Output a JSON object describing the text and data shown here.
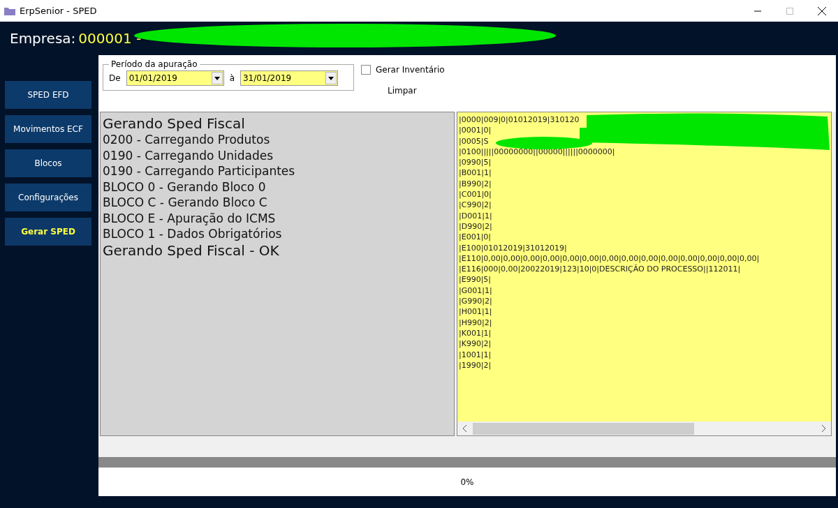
{
  "window": {
    "title": "ErpSenior - SPED"
  },
  "header": {
    "label": "Empresa:",
    "code": "000001 -"
  },
  "nav": [
    {
      "label": "SPED EFD",
      "selected": false
    },
    {
      "label": "Movimentos ECF",
      "selected": false
    },
    {
      "label": "Blocos",
      "selected": false
    },
    {
      "label": "Configurações",
      "selected": false
    },
    {
      "label": "Gerar SPED",
      "selected": true
    }
  ],
  "period": {
    "legend": "Período da apuração",
    "from_label": "De",
    "from": "01/01/2019",
    "to_label": "à",
    "to": "31/01/2019"
  },
  "inventory": {
    "label": "Gerar Inventário",
    "checked": false
  },
  "clear_button": "Limpar",
  "log": [
    {
      "text": "Gerando Sped Fiscal",
      "kind": "heading"
    },
    {
      "text": "0200 - Carregando Produtos",
      "kind": "step"
    },
    {
      "text": "0190 - Carregando Unidades",
      "kind": "step"
    },
    {
      "text": "0190 - Carregando Participantes",
      "kind": "step"
    },
    {
      "text": "BLOCO 0 - Gerando Bloco 0",
      "kind": "step"
    },
    {
      "text": "BLOCO C - Gerando Bloco C",
      "kind": "step"
    },
    {
      "text": "BLOCO E - Apuração do ICMS",
      "kind": "step"
    },
    {
      "text": "BLOCO 1 - Dados Obrigatórios",
      "kind": "step"
    },
    {
      "text": "Gerando Sped Fiscal - OK",
      "kind": "heading"
    }
  ],
  "output_lines": [
    "|0000|009|0|01012019|310120",
    "|0001|0|",
    "|0005|S",
    "|0100|||||00000000||00000||||||0000000|",
    "|0990|5|",
    "|B001|1|",
    "|B990|2|",
    "|C001|0|",
    "|C990|2|",
    "|D001|1|",
    "|D990|2|",
    "|E001|0|",
    "|E100|01012019|31012019|",
    "|E110|0,00|0,00|0,00|0,00|0,00|0,00|0,00|0,00|0,00|0,00|0,00|0,00|0,00|0,00|",
    "|E116|000|0,00|20022019|123|10|0|DESCRIÇÃO DO PROCESSO||112011|",
    "|E990|5|",
    "|G001|1|",
    "|G990|2|",
    "|H001|1|",
    "|H990|2|",
    "|K001|1|",
    "|K990|2|",
    "|1001|1|",
    "|1990|2|"
  ],
  "progress": {
    "level": 0,
    "reading": "0%"
  }
}
